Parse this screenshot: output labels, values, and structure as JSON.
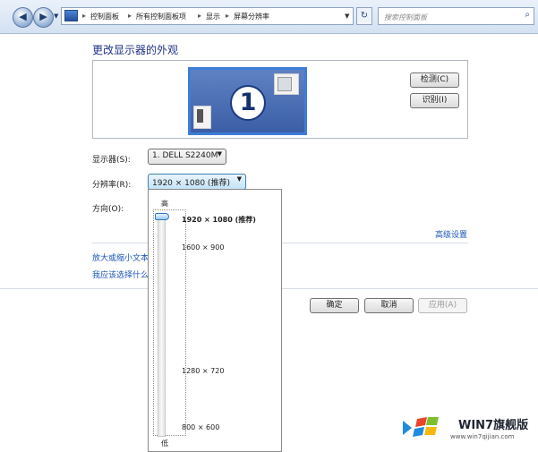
{
  "nav": {
    "back_icon": "back-arrow-icon",
    "forward_icon": "forward-arrow-icon"
  },
  "address_bar": {
    "crumbs": [
      "控制面板",
      "所有控制面板项",
      "显示",
      "屏幕分辨率"
    ],
    "search_placeholder": "搜索控制面板"
  },
  "page": {
    "title": "更改显示器的外观",
    "monitor_number": "1",
    "detect_button": "检测(C)",
    "identify_button": "识别(I)"
  },
  "settings": {
    "display_label": "显示器(S):",
    "display_value": "1. DELL S2240M",
    "resolution_label": "分辨率(R):",
    "resolution_value": "1920 × 1080 (推荐)",
    "orientation_label": "方向(O):",
    "advanced_link": "高级设置",
    "link_text_size": "放大或缩小文本",
    "link_which": "我应该选择什么"
  },
  "resolution_dropdown": {
    "high_label": "高",
    "low_label": "低",
    "options": [
      {
        "label": "1920 × 1080 (推荐)",
        "selected": true
      },
      {
        "label": "1600 × 900",
        "selected": false
      },
      {
        "label": "1280 × 720",
        "selected": false
      },
      {
        "label": "800 × 600",
        "selected": false
      }
    ]
  },
  "footer": {
    "ok_button": "确定",
    "cancel_button": "取消",
    "apply_button": "应用(A)"
  },
  "watermark": {
    "text": "WIN7旗舰版",
    "url": "www.win7qijian.com"
  },
  "colors": {
    "accent": "#3d7ed6",
    "link": "#1a53b8",
    "title": "#1e3287"
  }
}
